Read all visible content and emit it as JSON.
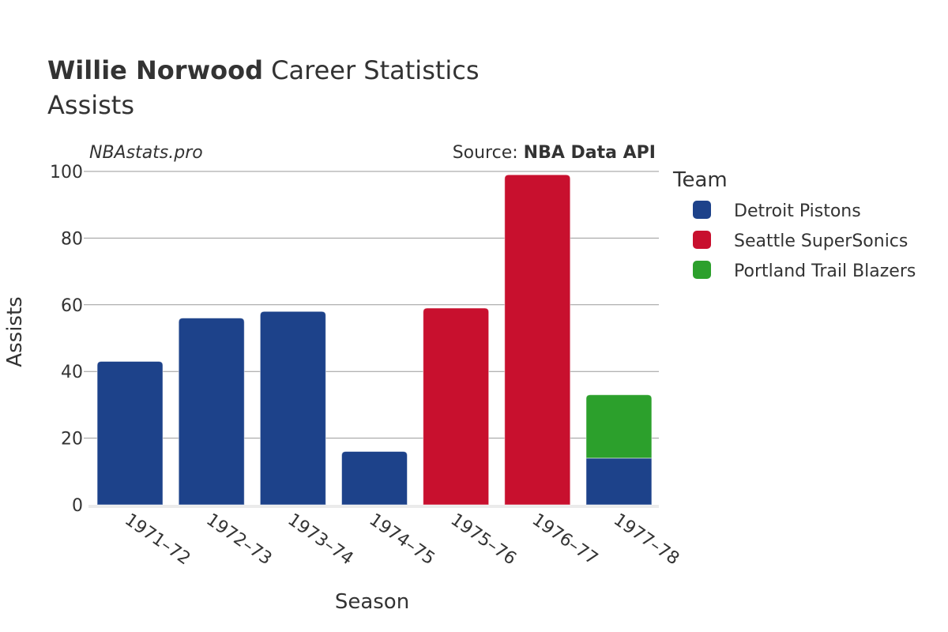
{
  "title": {
    "bold": "Willie Norwood",
    "rest": " Career Statistics",
    "subtitle": "Assists"
  },
  "brand": "NBAstats.pro",
  "source": {
    "prefix": "Source: ",
    "name": "NBA Data API"
  },
  "chart_data": {
    "type": "bar",
    "stacked": true,
    "title": "Willie Norwood Career Statistics",
    "subtitle": "Assists",
    "xlabel": "Season",
    "ylabel": "Assists",
    "ylim": [
      0,
      100
    ],
    "yticks": [
      0,
      20,
      40,
      60,
      80,
      100
    ],
    "grid": true,
    "legend_title": "Team",
    "legend_position": "right",
    "categories": [
      "1971–72",
      "1972–73",
      "1973–74",
      "1974–75",
      "1975–76",
      "1976–77",
      "1977–78"
    ],
    "series": [
      {
        "name": "Detroit Pistons",
        "color": "#1d428a",
        "values": [
          43,
          56,
          58,
          16,
          0,
          0,
          14
        ]
      },
      {
        "name": "Seattle SuperSonics",
        "color": "#c8102e",
        "values": [
          0,
          0,
          0,
          0,
          59,
          99,
          0
        ]
      },
      {
        "name": "Portland Trail Blazers",
        "color": "#2ca02c",
        "values": [
          0,
          0,
          0,
          0,
          0,
          0,
          19
        ]
      }
    ]
  }
}
